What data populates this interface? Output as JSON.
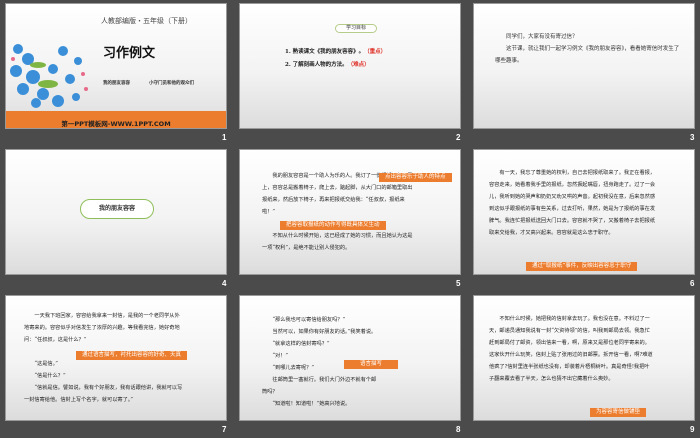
{
  "slides": [
    {
      "number": "1",
      "edition": "人教部编版・五年级（下册）",
      "title": "习作例文",
      "subtitle_left": "我的朋友容容",
      "subtitle_right": "小守门员和他的观众们",
      "footer": "第一PPT模板网-WWW.1PPT.COM"
    },
    {
      "number": "2",
      "badge": "学习目标",
      "item1": "1. 熟读课文《我的朋友容容》。",
      "item1_tag": "（重点）",
      "item2": "2. 了解刻画人物的方法。",
      "item2_tag": "（难点）"
    },
    {
      "number": "3",
      "line1": "同学们，大家有没有寄过信？",
      "line2": "这节课，就让我们一起学习例文《我的朋友容容》，看看她寄信时发生了哪些趣事。"
    },
    {
      "number": "4",
      "title": "我的朋友容容"
    },
    {
      "number": "5",
      "para1": "我的朋友容容是一个助人为乐的人。我订了一份报纸，每天早上，容容总是搬着椅子，爬上去，踮起脚，从大门口的邮箱里取出报纸来，然后放下椅子，再来把报纸交给我：“任叔叔，报纸来啦！”",
      "para2": "不知从什么时候开始，这已经成了她的习惯，而且她认为这是一项“权利”，是绝不能让别人侵犯的。",
      "note1": "点出容容乐于助人的特点",
      "note2": "把容容取报纸的动作写得既具体又生动"
    },
    {
      "number": "6",
      "para1": "有一天，我忘了尊重她的权利，自己去把报纸取来了。我正在看报，容容走来，她看着我手里的报纸，忽然撅起嘴唇，扭身跑走了。过了一会儿，我听到她的哭声和奶奶又劝又哄的声音。起初我没在意，后来忽然感到这似乎跟报纸的事有些关系，过去打听，果然，她是为了报纸的事在发脾气。我连忙把报纸送回大门口去。容容就不哭了，又搬着椅子去把报纸取来交给我，才又高兴起来。容容就是这么忠于职守。",
      "note": "通过“取报纸”事件，反映出容容忠于职守"
    },
    {
      "number": "7",
      "para1": "一天我下班回家，容容给我拿来一封信，是我的一个老同学从外地寄来的。容容似乎对信发生了浓厚的兴趣，等我看完信，她好奇地问：“任叔叔，这是什么？”",
      "para2": "“这是信。”",
      "para3": "“信是什么？”",
      "para4": "“信就是信。譬如说，我有个好朋友，我有话跟他讲，我就可以写一封信寄给他。信封上写个名字，就可以寄了。”",
      "note": "通过语言描写，衬托出容容的好奇、天真"
    },
    {
      "number": "8",
      "lines": [
        "“那么我也可以寄信给朋友吗？”",
        "当然可以，如果你有好朋友的话。”我笑着说。",
        "“就拿这样的信封寄吗？”",
        "“对！”",
        "“到哪儿去寄呢？”",
        "往邮筒里一塞就行。我们大门外边不就有个邮"
      ],
      "line_wrap": "筒吗？",
      "last": "“知道啦！知道啦！”她高兴地说。",
      "note": "语言描写"
    },
    {
      "number": "9",
      "para1": "不知什么时候，她把我的信封拿去玩了。我也没在意。不料过了一天，邮递员通知我说有一封“欠资待领”的信，叫我到邮局去领。我急忙赶到邮局付了邮资，领出信来一看，啊，原来又是那位老同学寄来的。这家伙开什么玩笑，信封上贴了张用过的旧邮票。拆开信一看，啊?难道他疯了?信封里连半张纸也没有，却装着片梧桐树叶。真是奇怪!我把叶子翻来覆去看了半天，怎么也猜不出它藏着什么奥妙。",
      "note": "为容容寄信做铺垫"
    }
  ],
  "colors": {
    "accent": "#ec7d2e",
    "red": "#e0342b",
    "background": "#4b4b4b"
  }
}
